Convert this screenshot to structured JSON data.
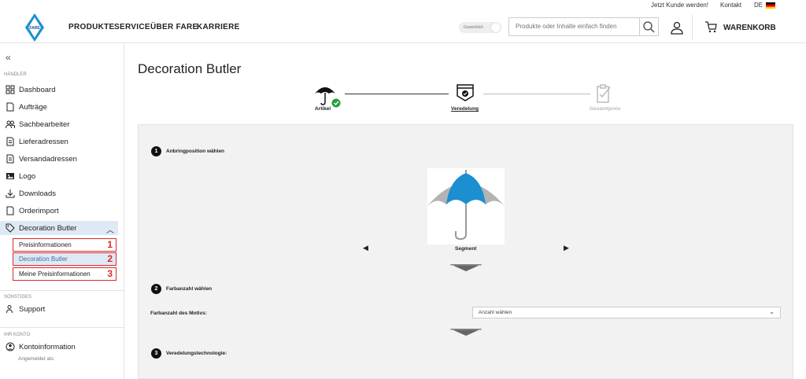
{
  "topbar": {
    "customer": "Jetzt Kunde werden!",
    "contact": "Kontakt",
    "lang": "DE"
  },
  "header": {
    "nav": [
      "PRODUKTE",
      "SERVICE",
      "ÜBER FARE",
      "KARRIERE"
    ],
    "toggle_label": "Gewerblich",
    "search_placeholder": "Produkte oder Inhalte einfach finden",
    "cart": "WARENKORB",
    "logo_text": "FARE"
  },
  "sidebar": {
    "section_dealer": "HÄNDLER",
    "items": [
      "Dashboard",
      "Aufträge",
      "Sachbearbeiter",
      "Lieferadressen",
      "Versandadressen",
      "Logo",
      "Downloads",
      "Orderimport",
      "Decoration Butler"
    ],
    "subitems": [
      {
        "label": "Preisinformationen",
        "num": "1"
      },
      {
        "label": "Decoration Butler",
        "num": "2"
      },
      {
        "label": "Meine Preisinformationen",
        "num": "3"
      }
    ],
    "section_other": "SONSTIGES",
    "support": "Support",
    "section_account": "IHR KONTO",
    "account": "Kontoinformation",
    "logged_in": "Angemeldet als:"
  },
  "main": {
    "title": "Decoration Butler",
    "steps": [
      "Artikel",
      "Veredelung",
      "Gesamtpreis"
    ],
    "s1_num": "1",
    "s1_title": "Anbringposition wählen",
    "segment": "Segment",
    "s2_num": "2",
    "s2_title": "Farbanzahl wählen",
    "field_label": "Farbanzahl des Motivs:",
    "select_value": "Anzahl wählen",
    "s3_num": "3",
    "s3_title": "Veredelungstechnologie:"
  },
  "colors": {
    "accent": "#1b8fd0",
    "active_bg": "#dfe9f5",
    "highlight": "#d92a2a",
    "check": "#2a9d3a"
  }
}
